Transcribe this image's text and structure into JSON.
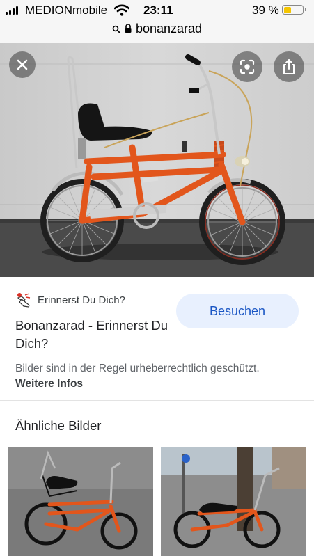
{
  "status_bar": {
    "carrier": "MEDIONmobile",
    "time": "23:11",
    "battery_percent": "39 %",
    "battery_level": 0.39
  },
  "url_bar": {
    "domain": "bonanzarad"
  },
  "result": {
    "source_name": "Erinnerst Du Dich?",
    "title": "Bonanzarad - Erinnerst Du Dich?",
    "visit_label": "Besuchen",
    "copyright_text": "Bilder sind in der Regel urheberrechtlich geschützt.",
    "more_info_label": "Weitere Infos"
  },
  "similar": {
    "heading": "Ähnliche Bilder"
  },
  "icons": {
    "close": "close-icon",
    "lens": "lens-icon",
    "share": "share-icon",
    "search": "search-icon",
    "lock": "lock-icon",
    "source": "hand-pointer-icon"
  },
  "colors": {
    "accent": "#1a56c4",
    "visit_bg": "#e8f0fe",
    "battery": "#f4c500",
    "bike": "#e2561c"
  }
}
